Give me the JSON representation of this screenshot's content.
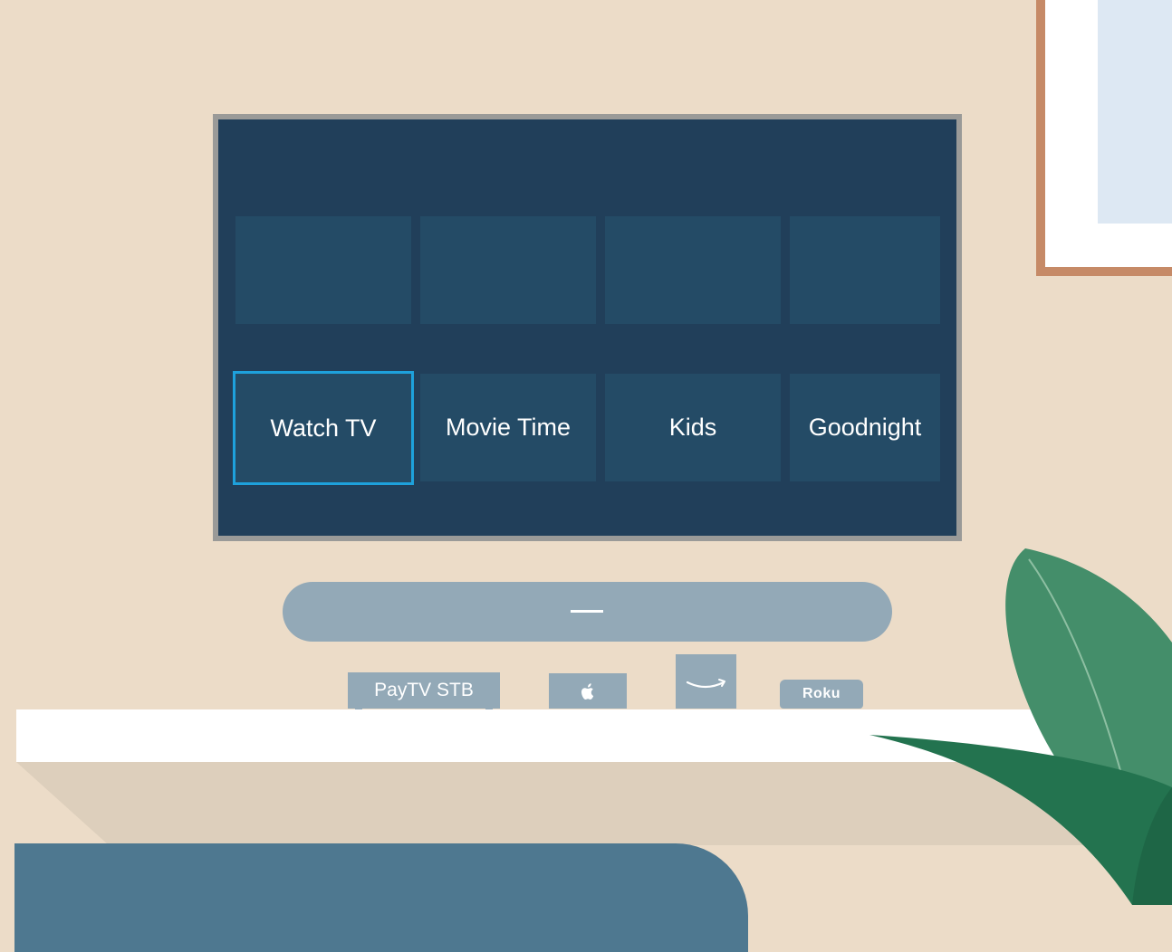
{
  "tv": {
    "tiles_top": [
      "",
      "",
      "",
      ""
    ],
    "activities": [
      {
        "label": "Watch TV",
        "selected": true
      },
      {
        "label": "Movie Time",
        "selected": false
      },
      {
        "label": "Kids",
        "selected": false
      },
      {
        "label": "Goodnight",
        "selected": false
      }
    ]
  },
  "devices": {
    "stb_label": "PayTV STB",
    "apple_icon": "apple-logo",
    "fire_icon": "amazon-smile",
    "roku_label": "Roku"
  },
  "colors": {
    "wall": "#ecdcc8",
    "screen": "#213f5a",
    "tile": "#244b66",
    "selection": "#1ea1dc",
    "device": "#93a9b7",
    "sofa": "#4e7890",
    "plant_light": "#448e6a",
    "plant_dark": "#23734f"
  }
}
